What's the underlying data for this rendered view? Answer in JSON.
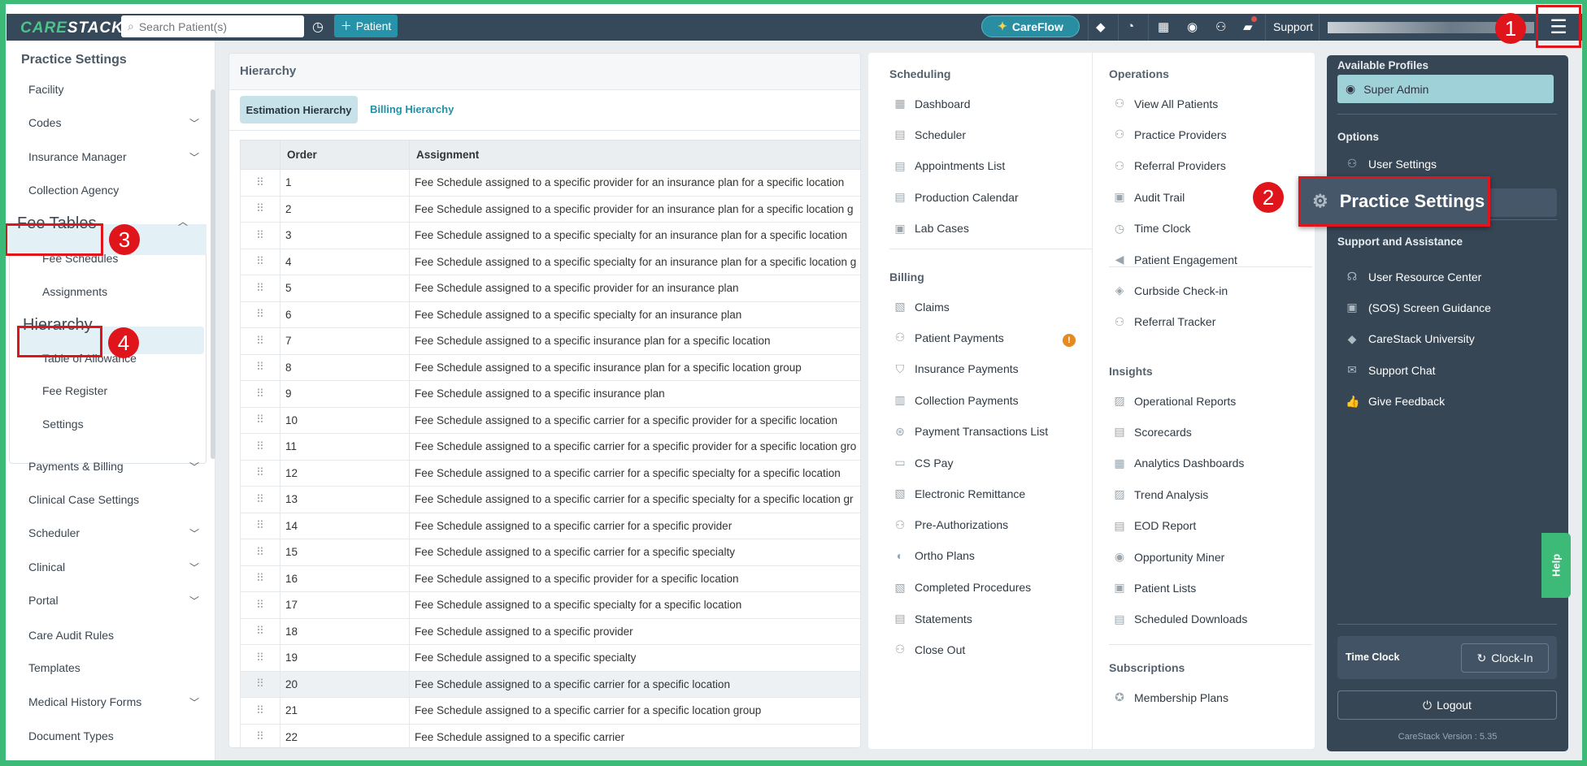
{
  "header": {
    "logo": "CARESTACK",
    "search_placeholder": "Search Patient(s)",
    "add_patient": "Patient",
    "careflow": "CareFlow",
    "support": "Support"
  },
  "sidebar": {
    "title": "Practice Settings",
    "items": [
      {
        "label": "Facility",
        "chev": false
      },
      {
        "label": "Codes",
        "chev": true
      },
      {
        "label": "Insurance Manager",
        "chev": true
      },
      {
        "label": "Collection Agency",
        "chev": false
      },
      {
        "label": "Fee Tables",
        "chev": "up"
      },
      {
        "label": "Fee Schedules",
        "sub": true
      },
      {
        "label": "Assignments",
        "sub": true
      },
      {
        "label": "Hierarchy",
        "sub": true,
        "active": true
      },
      {
        "label": "Table of Allowance",
        "sub": true
      },
      {
        "label": "Fee Register",
        "sub": true
      },
      {
        "label": "Settings",
        "sub": true
      },
      {
        "label": "Payments & Billing",
        "chev": true
      },
      {
        "label": "Clinical Case Settings",
        "chev": false
      },
      {
        "label": "Scheduler",
        "chev": true
      },
      {
        "label": "Clinical",
        "chev": true
      },
      {
        "label": "Portal",
        "chev": true
      },
      {
        "label": "Care Audit Rules",
        "chev": false
      },
      {
        "label": "Templates",
        "chev": false
      },
      {
        "label": "Medical History Forms",
        "chev": true
      },
      {
        "label": "Document Types",
        "chev": false
      }
    ]
  },
  "card": {
    "title": "Hierarchy",
    "tabs": [
      "Estimation Hierarchy",
      "Billing Hierarchy"
    ],
    "columns": [
      "Order",
      "Assignment"
    ],
    "rows": [
      [
        "1",
        "Fee Schedule assigned to a specific provider for an insurance plan for a specific location"
      ],
      [
        "2",
        "Fee Schedule assigned to a specific provider for an insurance plan for a specific location g"
      ],
      [
        "3",
        "Fee Schedule assigned to a specific specialty for an insurance plan for a specific location"
      ],
      [
        "4",
        "Fee Schedule assigned to a specific specialty for an insurance plan for a specific location g"
      ],
      [
        "5",
        "Fee Schedule assigned to a specific provider for an insurance plan"
      ],
      [
        "6",
        "Fee Schedule assigned to a specific specialty for an insurance plan"
      ],
      [
        "7",
        "Fee Schedule assigned to a specific insurance plan for a specific location"
      ],
      [
        "8",
        "Fee Schedule assigned to a specific insurance plan for a specific location group"
      ],
      [
        "9",
        "Fee Schedule assigned to a specific insurance plan"
      ],
      [
        "10",
        "Fee Schedule assigned to a specific carrier for a specific provider for a specific location"
      ],
      [
        "11",
        "Fee Schedule assigned to a specific carrier for a specific provider for a specific location gro"
      ],
      [
        "12",
        "Fee Schedule assigned to a specific carrier for a specific specialty for a specific location"
      ],
      [
        "13",
        "Fee Schedule assigned to a specific carrier for a specific specialty for a specific location gr"
      ],
      [
        "14",
        "Fee Schedule assigned to a specific carrier for a specific provider"
      ],
      [
        "15",
        "Fee Schedule assigned to a specific carrier for a specific specialty"
      ],
      [
        "16",
        "Fee Schedule assigned to a specific provider for a specific location"
      ],
      [
        "17",
        "Fee Schedule assigned to a specific specialty for a specific location"
      ],
      [
        "18",
        "Fee Schedule assigned to a specific provider"
      ],
      [
        "19",
        "Fee Schedule assigned to a specific specialty"
      ],
      [
        "20",
        "Fee Schedule assigned to a specific carrier for a specific location"
      ],
      [
        "21",
        "Fee Schedule assigned to a specific carrier for a specific location group"
      ],
      [
        "22",
        "Fee Schedule assigned to a specific carrier"
      ]
    ]
  },
  "menu": {
    "scheduling": {
      "title": "Scheduling",
      "items": [
        [
          "Dashboard",
          "▦"
        ],
        [
          "Scheduler",
          "▤"
        ],
        [
          "Appointments List",
          "▤"
        ],
        [
          "Production Calendar",
          "▤"
        ],
        [
          "Lab Cases",
          "▣"
        ]
      ]
    },
    "billing": {
      "title": "Billing",
      "items": [
        [
          "Claims",
          "▧"
        ],
        [
          "Patient Payments",
          "⚇"
        ],
        [
          "Insurance Payments",
          "⛉"
        ],
        [
          "Collection Payments",
          "▥"
        ],
        [
          "Payment Transactions List",
          "⊛"
        ],
        [
          "CS Pay",
          "▭"
        ],
        [
          "Electronic Remittance",
          "▧"
        ],
        [
          "Pre-Authorizations",
          "⚇"
        ],
        [
          "Ortho Plans",
          "◐"
        ],
        [
          "Completed Procedures",
          "▧"
        ],
        [
          "Statements",
          "▤"
        ],
        [
          "Close Out",
          "⚇"
        ]
      ]
    },
    "billing_badge": "!",
    "operations": {
      "title": "Operations",
      "items": [
        [
          "View All Patients",
          "⚇"
        ],
        [
          "Practice Providers",
          "⚇"
        ],
        [
          "Referral Providers",
          "⚇"
        ],
        [
          "Audit Trail",
          "▣"
        ],
        [
          "Time Clock",
          "◷"
        ],
        [
          "Patient Engagement",
          "◀"
        ],
        [
          "Curbside Check-in",
          "◈"
        ],
        [
          "Referral Tracker",
          "⚇"
        ]
      ]
    },
    "insights": {
      "title": "Insights",
      "items": [
        [
          "Operational Reports",
          "▨"
        ],
        [
          "Scorecards",
          "▤"
        ],
        [
          "Analytics Dashboards",
          "▦"
        ],
        [
          "Trend Analysis",
          "▨"
        ],
        [
          "EOD Report",
          "▤"
        ],
        [
          "Opportunity Miner",
          "◉"
        ],
        [
          "Patient Lists",
          "▣"
        ],
        [
          "Scheduled Downloads",
          "▤"
        ]
      ]
    },
    "subscriptions": {
      "title": "Subscriptions",
      "items": [
        [
          "Membership Plans",
          "✪"
        ]
      ]
    }
  },
  "panel": {
    "profiles_title": "Available Profiles",
    "profile": "Super Admin",
    "options_title": "Options",
    "user_settings": "User Settings",
    "practice_settings": "Practice Settings",
    "support_title": "Support and Assistance",
    "support_items": [
      [
        "User Resource Center",
        "☊"
      ],
      [
        "(SOS) Screen Guidance",
        "▣"
      ],
      [
        "CareStack University",
        "◆"
      ],
      [
        "Support Chat",
        "✉"
      ],
      [
        "Give Feedback",
        "👍"
      ]
    ],
    "time_clock": "Time Clock",
    "clock_in": "Clock-In",
    "logout": "Logout",
    "version": "CareStack Version : 5.35"
  },
  "help": "Help",
  "annotations": [
    "1",
    "2",
    "3",
    "4"
  ]
}
